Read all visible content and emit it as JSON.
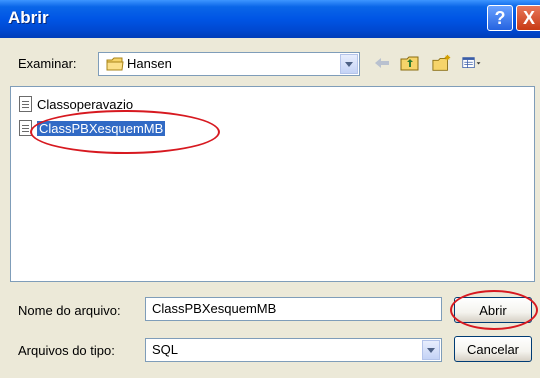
{
  "window": {
    "title": "Abrir"
  },
  "titlebar": {
    "help_label": "?",
    "close_label": "X"
  },
  "toolbar": {
    "look_in_label": "Examinar:",
    "look_in_value": "Hansen",
    "icons": [
      "back-icon",
      "up-folder-icon",
      "new-folder-icon",
      "views-menu-icon"
    ]
  },
  "files": [
    {
      "name": "Classoperavazio",
      "selected": false
    },
    {
      "name": "ClassPBXesquemMB",
      "selected": true
    }
  ],
  "fields": {
    "file_name_label": "Nome do arquivo:",
    "file_name_value": "ClassPBXesquemMB",
    "file_type_label": "Arquivos do tipo:",
    "file_type_value": "SQL"
  },
  "buttons": {
    "open": "Abrir",
    "cancel": "Cancelar"
  },
  "colors": {
    "titlebar": "#0055E5",
    "selection": "#316AC5",
    "annotation": "#D71920",
    "dialog_bg": "#ECE9D8"
  }
}
